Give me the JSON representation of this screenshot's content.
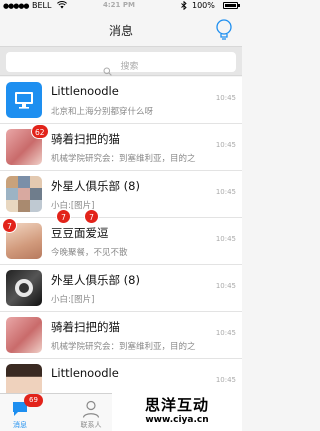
{
  "status_bar": {
    "signal": "●●●●●",
    "carrier": "BELL",
    "time": "4:21 PM",
    "battery": "100%"
  },
  "nav": {
    "title": "消息",
    "action_icon": "bulb-icon"
  },
  "search": {
    "placeholder": "搜索"
  },
  "conversations": [
    {
      "title": "Littlenoodle",
      "snippet": "北京和上海分别都穿什么呀",
      "time": "10:45",
      "avatar": "monitor-icon"
    },
    {
      "title": "骑着扫把的猫",
      "snippet": "机械学院研究会：到塞维利亚，目的之",
      "time": "10:45",
      "badge": "62"
    },
    {
      "title": "外星人俱乐部 (8)",
      "snippet": "小白:[图片]",
      "time": "10:45"
    },
    {
      "title": "豆豆面爱逗",
      "snippet": "今晚聚餐，不见不散",
      "time": "10:45",
      "badges": [
        "7",
        "7",
        "7"
      ]
    },
    {
      "title": "外星人俱乐部 (8)",
      "snippet": "小白:[图片]",
      "time": "10:45"
    },
    {
      "title": "骑着扫把的猫",
      "snippet": "机械学院研究会：到塞维利亚，目的之",
      "time": "10:45"
    },
    {
      "title": "Littlenoodle",
      "snippet": "",
      "time": "10:45"
    }
  ],
  "tabs": [
    {
      "label": "消息",
      "badge": "69",
      "icon": "chat-icon",
      "active": true
    },
    {
      "label": "联系人",
      "icon": "person-icon",
      "active": false
    }
  ],
  "watermark": {
    "main": "思洋互动",
    "url": "www.ciya.cn"
  },
  "colors": {
    "accent": "#1e8ff0",
    "badge": "#e2231a"
  }
}
